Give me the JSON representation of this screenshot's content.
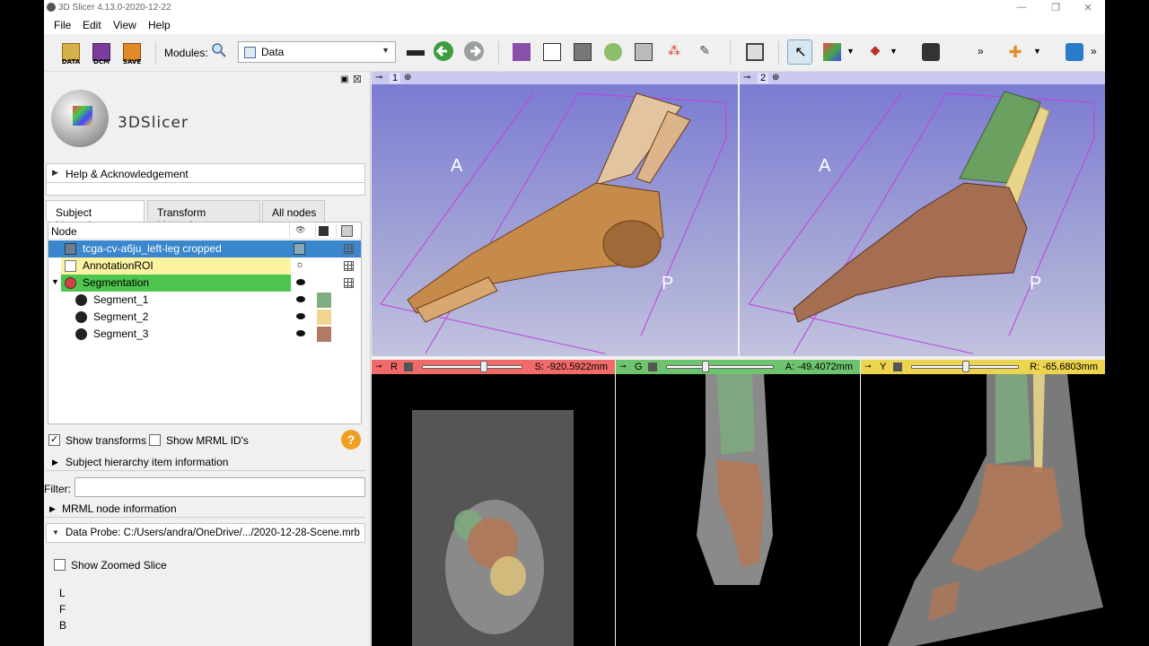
{
  "window": {
    "title": "3D Slicer 4.13.0-2020-12-22"
  },
  "menu": [
    "File",
    "Edit",
    "View",
    "Help"
  ],
  "toolbar": {
    "data_label": "DATA",
    "dcm_label": "DCM",
    "save_label": "SAVE",
    "modules_label": "Modules:",
    "module_selected": "Data"
  },
  "left_panel": {
    "logo_text": "3DSlicer",
    "help_section": "Help & Acknowledgement",
    "tabs": [
      "Subject hierarchy",
      "Transform hierarchy",
      "All nodes"
    ],
    "tree": {
      "header": "Node",
      "rows": [
        {
          "label": "tcga-cv-a6ju_left-leg cropped",
          "bg": "#3a87cd",
          "fg": "#ffffff"
        },
        {
          "label": "AnnotationROI",
          "bg": "#fcf3a2",
          "fg": "#000000"
        },
        {
          "label": "Segmentation",
          "bg": "#4ec54e",
          "fg": "#000000"
        },
        {
          "label": "Segment_1",
          "color": "#80ae80"
        },
        {
          "label": "Segment_2",
          "color": "#f1d691"
        },
        {
          "label": "Segment_3",
          "color": "#b17a65"
        }
      ]
    },
    "show_transforms": "Show transforms",
    "show_mrml_ids": "Show MRML ID's",
    "item_info": "Subject hierarchy item information",
    "filter_label": "Filter:",
    "mrml_info": "MRML node information",
    "data_probe": "Data Probe: C:/Users/andra/OneDrive/.../2020-12-28-Scene.mrb",
    "show_zoomed": "Show Zoomed Slice",
    "probe_lines": [
      "L",
      "F",
      "B"
    ]
  },
  "views": {
    "view1_label": "1",
    "view2_label": "2",
    "orient_a": "A",
    "orient_p": "P",
    "red": {
      "letter": "R",
      "value": "S: -920.5922mm",
      "color": "#f06a6a",
      "pos": 0.62
    },
    "green": {
      "letter": "G",
      "value": "A: -49.4072mm",
      "color": "#6ec46e",
      "pos": 0.35
    },
    "yellow": {
      "letter": "Y",
      "value": "R: -65.6803mm",
      "color": "#ecd44e",
      "pos": 0.5
    }
  }
}
